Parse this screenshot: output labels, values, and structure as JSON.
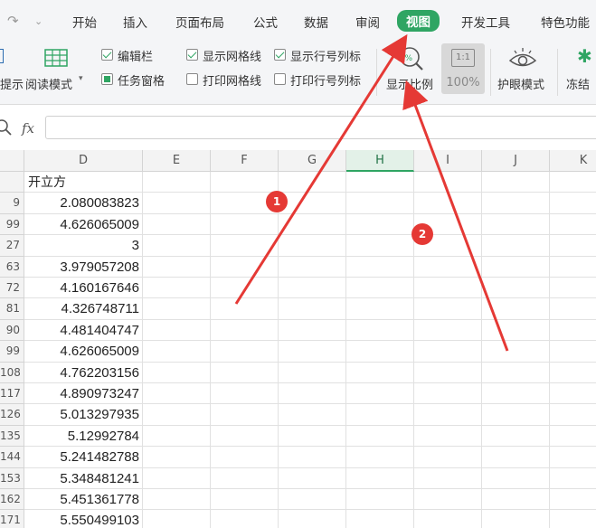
{
  "menu": {
    "items": [
      "开始",
      "插入",
      "页面布局",
      "公式",
      "数据",
      "审阅",
      "视图",
      "开发工具",
      "特色功能"
    ],
    "active": "视图"
  },
  "ribbon": {
    "partial_left_label": "提示",
    "reading_mode": "阅读模式",
    "checkboxes": {
      "edit_bar": {
        "label": "编辑栏",
        "checked": true
      },
      "task_pane": {
        "label": "任务窗格",
        "checked": true
      },
      "show_gridlines": {
        "label": "显示网格线",
        "checked": true
      },
      "print_gridlines": {
        "label": "打印网格线",
        "checked": false
      },
      "show_row_col_headers": {
        "label": "显示行号列标",
        "checked": true
      },
      "print_row_col_headers": {
        "label": "打印行号列标",
        "checked": false
      }
    },
    "zoom_label": "显示比例",
    "zoom_value": "100%",
    "zoom_ratio_icon": "1:1",
    "eye_mode": "护眼模式",
    "freeze_partial": "冻结"
  },
  "formula_bar": {
    "fx": "fx",
    "value": ""
  },
  "grid": {
    "columns": [
      "D",
      "E",
      "F",
      "G",
      "H",
      "I",
      "J",
      "K"
    ],
    "selected_column": "H",
    "row_labels": [
      "",
      "9",
      "99",
      "27",
      "63",
      "72",
      "81",
      "90",
      "99",
      "108",
      "117",
      "126",
      "135",
      "144",
      "153",
      "162",
      "171"
    ],
    "d_values": [
      "开立方",
      "2.080083823",
      "4.626065009",
      "3",
      "3.979057208",
      "4.160167646",
      "4.326748711",
      "4.481404747",
      "4.626065009",
      "4.762203156",
      "4.890973247",
      "5.013297935",
      "5.12992784",
      "5.241482788",
      "5.348481241",
      "5.451361778",
      "5.550499103"
    ]
  },
  "annotations": {
    "markers": [
      "1",
      "2"
    ],
    "color": "#e53935"
  },
  "accent_color": "#2fa563"
}
